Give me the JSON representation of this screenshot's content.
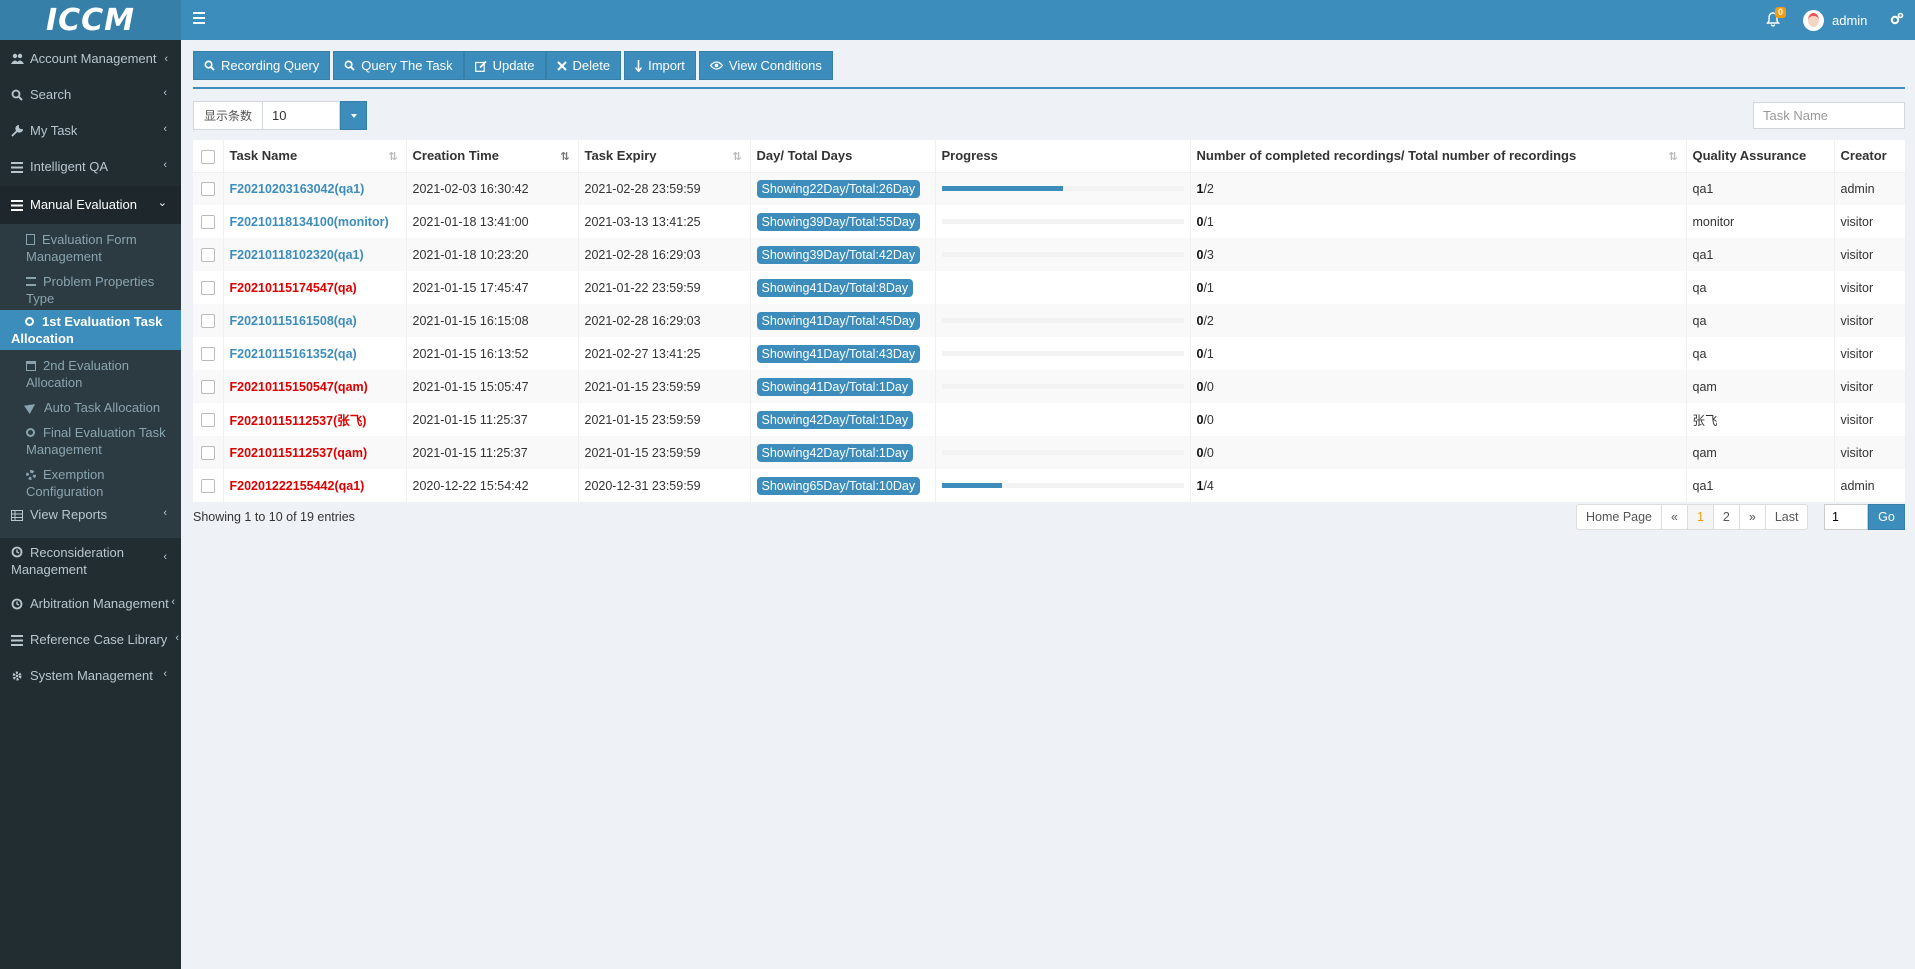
{
  "app": {
    "logo_text": "ICCM"
  },
  "header": {
    "notification_count": "0",
    "username": "admin"
  },
  "colors": {
    "primary": "#3c8dbc",
    "sidebar_bg": "#222d32",
    "warning": "#f39c12",
    "danger": "#dd0000"
  },
  "sidebar": {
    "items": [
      {
        "label": "Account Management",
        "icon": "users-icon"
      },
      {
        "label": "Search",
        "icon": "search-icon"
      },
      {
        "label": "My Task",
        "icon": "wrench-icon"
      },
      {
        "label": "Intelligent QA",
        "icon": "list-icon"
      },
      {
        "label": "Manual Evaluation",
        "icon": "list-icon",
        "expanded": true
      },
      {
        "label": "View Reports",
        "icon": "table-icon"
      },
      {
        "label": "Reconsideration Management",
        "icon": "circle-icon"
      },
      {
        "label": "Arbitration Management",
        "icon": "circle-icon"
      },
      {
        "label": "Reference Case Library",
        "icon": "list-icon"
      },
      {
        "label": "System Management",
        "icon": "gear-icon"
      }
    ],
    "submenu": [
      {
        "label": "Evaluation Form Management",
        "icon": "file-icon"
      },
      {
        "label": "Problem Properties Type",
        "icon": "list-icon"
      },
      {
        "label": "1st Evaluation Task Allocation",
        "icon": "circle-icon",
        "active": true
      },
      {
        "label": "2nd Evaluation Allocation",
        "icon": "calendar-icon"
      },
      {
        "label": "Auto Task Allocation",
        "icon": "send-icon"
      },
      {
        "label": "Final Evaluation Task Management",
        "icon": "circle-icon"
      },
      {
        "label": "Exemption Configuration",
        "icon": "gear-icon"
      }
    ]
  },
  "toolbar": {
    "recording_query": "Recording Query",
    "query_task": "Query The Task",
    "update": "Update",
    "delete": "Delete",
    "import": "Import",
    "view_conditions": "View Conditions"
  },
  "controls": {
    "page_size_label": "显示条数",
    "page_size_value": "10",
    "task_name_placeholder": "Task Name"
  },
  "table": {
    "headers": {
      "task_name": "Task Name",
      "creation_time": "Creation Time",
      "task_expiry": "Task Expiry",
      "days": "Day/ Total Days",
      "progress": "Progress",
      "recordings": "Number of completed recordings/ Total number of recordings",
      "qa": "Quality Assurance",
      "creator": "Creator"
    },
    "rows": [
      {
        "task_name": "F20210203163042(qa1)",
        "name_color": "blue",
        "creation_time": "2021-02-03 16:30:42",
        "task_expiry": "2021-02-28 23:59:59",
        "days": "Showing22Day/Total:26Day",
        "progress": 0.5,
        "completed": "1",
        "total": "/2",
        "qa": "qa1",
        "creator": "admin"
      },
      {
        "task_name": "F20210118134100(monitor)",
        "name_color": "blue",
        "creation_time": "2021-01-18 13:41:00",
        "task_expiry": "2021-03-13 13:41:25",
        "days": "Showing39Day/Total:55Day",
        "progress": 0,
        "completed": "0",
        "total": "/1",
        "qa": "monitor",
        "creator": "visitor"
      },
      {
        "task_name": "F20210118102320(qa1)",
        "name_color": "blue",
        "creation_time": "2021-01-18 10:23:20",
        "task_expiry": "2021-02-28 16:29:03",
        "days": "Showing39Day/Total:42Day",
        "progress": 0,
        "completed": "0",
        "total": "/3",
        "qa": "qa1",
        "creator": "visitor"
      },
      {
        "task_name": "F20210115174547(qa)",
        "name_color": "red",
        "creation_time": "2021-01-15 17:45:47",
        "task_expiry": "2021-01-22 23:59:59",
        "days": "Showing41Day/Total:8Day",
        "progress": null,
        "completed": "0",
        "total": "/1",
        "qa": "qa",
        "creator": "visitor"
      },
      {
        "task_name": "F20210115161508(qa)",
        "name_color": "blue",
        "creation_time": "2021-01-15 16:15:08",
        "task_expiry": "2021-02-28 16:29:03",
        "days": "Showing41Day/Total:45Day",
        "progress": 0,
        "completed": "0",
        "total": "/2",
        "qa": "qa",
        "creator": "visitor"
      },
      {
        "task_name": "F20210115161352(qa)",
        "name_color": "blue",
        "creation_time": "2021-01-15 16:13:52",
        "task_expiry": "2021-02-27 13:41:25",
        "days": "Showing41Day/Total:43Day",
        "progress": 0,
        "completed": "0",
        "total": "/1",
        "qa": "qa",
        "creator": "visitor"
      },
      {
        "task_name": "F20210115150547(qam)",
        "name_color": "red",
        "creation_time": "2021-01-15 15:05:47",
        "task_expiry": "2021-01-15 23:59:59",
        "days": "Showing41Day/Total:1Day",
        "progress": 0,
        "completed": "0",
        "total": "/0",
        "qa": "qam",
        "creator": "visitor"
      },
      {
        "task_name": "F20210115112537(张飞)",
        "name_color": "red",
        "creation_time": "2021-01-15 11:25:37",
        "task_expiry": "2021-01-15 23:59:59",
        "days": "Showing42Day/Total:1Day",
        "progress": null,
        "completed": "0",
        "total": "/0",
        "qa": "张飞",
        "creator": "visitor"
      },
      {
        "task_name": "F20210115112537(qam)",
        "name_color": "red",
        "creation_time": "2021-01-15 11:25:37",
        "task_expiry": "2021-01-15 23:59:59",
        "days": "Showing42Day/Total:1Day",
        "progress": 0,
        "completed": "0",
        "total": "/0",
        "qa": "qam",
        "creator": "visitor"
      },
      {
        "task_name": "F20201222155442(qa1)",
        "name_color": "red",
        "creation_time": "2020-12-22 15:54:42",
        "task_expiry": "2020-12-31 23:59:59",
        "days": "Showing65Day/Total:10Day",
        "progress": 0.25,
        "completed": "1",
        "total": "/4",
        "qa": "qa1",
        "creator": "admin"
      }
    ]
  },
  "footer": {
    "info": "Showing 1 to 10 of 19 entries",
    "pagination": [
      "Home Page",
      "«",
      "1",
      "2",
      "»",
      "Last"
    ],
    "current_page": "1",
    "goto_value": "1",
    "go_label": "Go"
  }
}
